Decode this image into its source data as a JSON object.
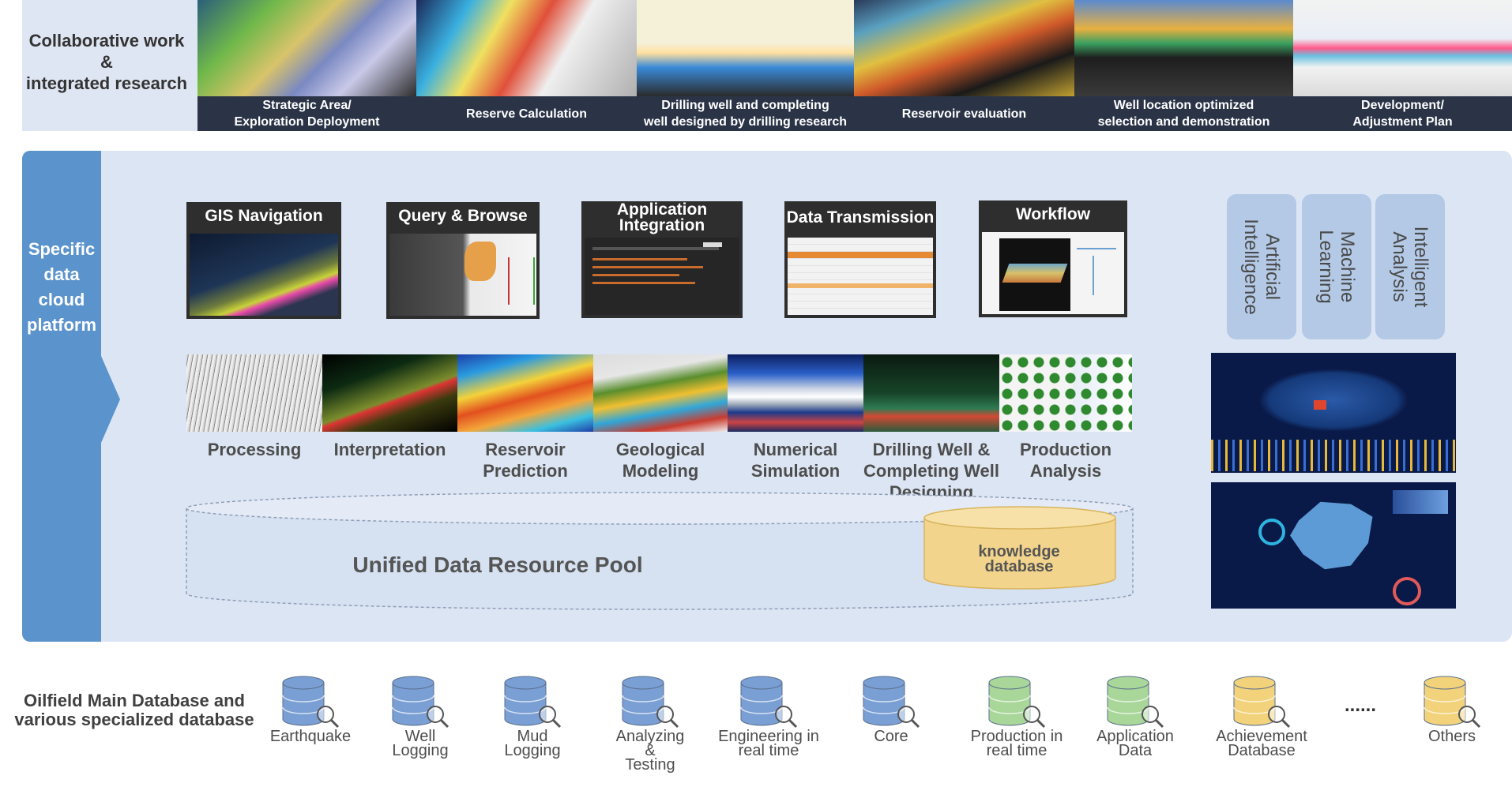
{
  "header": {
    "label": "Collaborative work\n&\nintegrated research",
    "stages": [
      "Strategic Area/\nExploration Deployment",
      "Reserve Calculation",
      "Drilling well and completing\nwell designed by drilling research",
      "Reservoir evaluation",
      "Well location optimized\nselection and demonstration",
      "Development/\nAdjustment Plan"
    ]
  },
  "platform": {
    "label": "Specific\ndata\ncloud\nplatform",
    "modules": [
      "GIS Navigation",
      "Query & Browse",
      "Application\nIntegration",
      "Data\nTransmission",
      "Workflow"
    ],
    "ai_cards": [
      "Artificial\nIntelligence",
      "Machine\nLearning",
      "Intelligent\nAnalysis"
    ],
    "processes": [
      "Processing",
      "Interpretation",
      "Reservoir\nPrediction",
      "Geological\nModeling",
      "Numerical\nSimulation",
      "Drilling Well &\nCompleting Well\nDesigning",
      "Production\nAnalysis"
    ],
    "pool_label": "Unified Data Resource Pool",
    "knowledge_label": "knowledge\ndatabase"
  },
  "databases": {
    "label": "Oilfield Main Database and\nvarious specialized database",
    "items": [
      {
        "name": "Earthquake",
        "color": "#7a9fd4"
      },
      {
        "name": "Well\nLogging",
        "color": "#7a9fd4"
      },
      {
        "name": "Mud\nLogging",
        "color": "#7a9fd4"
      },
      {
        "name": "Analyzing\n&\nTesting",
        "color": "#7a9fd4"
      },
      {
        "name": "Engineering in\nreal time",
        "color": "#7a9fd4"
      },
      {
        "name": "Core",
        "color": "#7a9fd4"
      },
      {
        "name": "Production in\nreal time",
        "color": "#a9d79a"
      },
      {
        "name": "Application\nData",
        "color": "#a9d79a"
      },
      {
        "name": "Achievement\nDatabase",
        "color": "#f2d27a"
      },
      {
        "name": "Others",
        "color": "#f2d27a"
      }
    ],
    "ellipsis": "......"
  },
  "colors": {
    "platform_tab": "#5b93cc",
    "platform_bg": "#dce5f3",
    "caption_bg": "#2b3447",
    "knowledge_fill": "#f3d48c"
  }
}
